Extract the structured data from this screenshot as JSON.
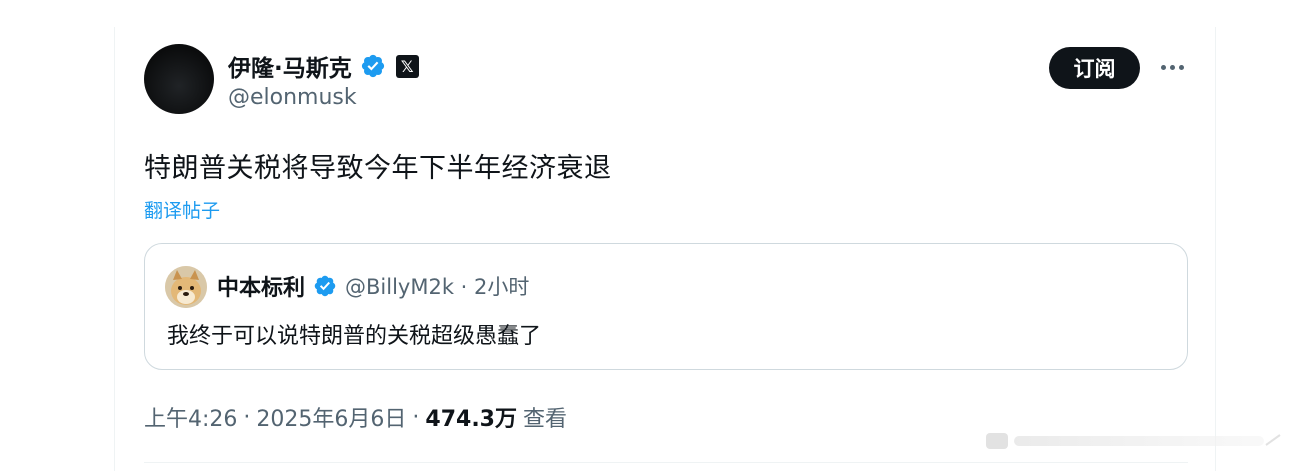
{
  "author": {
    "display_name": "伊隆·马斯克",
    "handle": "@elonmusk",
    "verified_icon": "verified-badge-icon",
    "affiliation_icon": "x-logo-icon",
    "affiliation_glyph": "𝕏"
  },
  "actions": {
    "subscribe_label": "订阅",
    "more_icon": "more-options-icon"
  },
  "tweet": {
    "text": "特朗普关税将导致今年下半年经济衰退",
    "translate_label": "翻译帖子"
  },
  "quoted_tweet": {
    "display_name": "中本标利",
    "handle_time": "@BillyM2k · 2小时",
    "text": "我终于可以说特朗普的关税超级愚蠢了"
  },
  "meta": {
    "time": "上午4:26",
    "sep1": "·",
    "date": "2025年6月6日",
    "sep2": "·",
    "views": "474.3万",
    "views_label": "查看"
  },
  "colors": {
    "accent": "#1d9bf0",
    "text_primary": "#0f1419",
    "text_secondary": "#536471",
    "border": "#cfd9de"
  }
}
